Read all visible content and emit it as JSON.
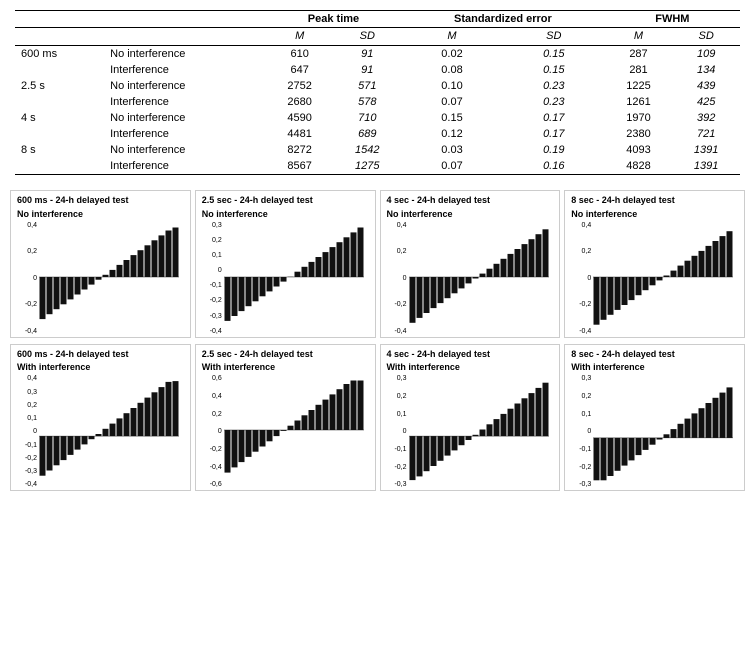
{
  "table": {
    "headers": {
      "groups": [
        {
          "label": "Peak time",
          "colspan": 2
        },
        {
          "label": "Standardized error",
          "colspan": 2
        },
        {
          "label": "FWHM",
          "colspan": 2
        }
      ],
      "subheaders": [
        "M",
        "SD",
        "M",
        "SD",
        "M",
        "SD"
      ]
    },
    "rows": [
      {
        "condition": "600 ms",
        "sub": "No interference",
        "peak_m": "610",
        "peak_sd": "91",
        "se_m": "0.02",
        "se_sd": "0.15",
        "fwhm_m": "287",
        "fwhm_sd": "109"
      },
      {
        "condition": "",
        "sub": "Interference",
        "peak_m": "647",
        "peak_sd": "91",
        "se_m": "0.08",
        "se_sd": "0.15",
        "fwhm_m": "281",
        "fwhm_sd": "134"
      },
      {
        "condition": "2.5 s",
        "sub": "No interference",
        "peak_m": "2752",
        "peak_sd": "571",
        "se_m": "0.10",
        "se_sd": "0.23",
        "fwhm_m": "1225",
        "fwhm_sd": "439"
      },
      {
        "condition": "",
        "sub": "Interference",
        "peak_m": "2680",
        "peak_sd": "578",
        "se_m": "0.07",
        "se_sd": "0.23",
        "fwhm_m": "1261",
        "fwhm_sd": "425"
      },
      {
        "condition": "4 s",
        "sub": "No interference",
        "peak_m": "4590",
        "peak_sd": "710",
        "se_m": "0.15",
        "se_sd": "0.17",
        "fwhm_m": "1970",
        "fwhm_sd": "392"
      },
      {
        "condition": "",
        "sub": "Interference",
        "peak_m": "4481",
        "peak_sd": "689",
        "se_m": "0.12",
        "se_sd": "0.17",
        "fwhm_m": "2380",
        "fwhm_sd": "721"
      },
      {
        "condition": "8 s",
        "sub": "No interference",
        "peak_m": "8272",
        "peak_sd": "1542",
        "se_m": "0.03",
        "se_sd": "0.19",
        "fwhm_m": "4093",
        "fwhm_sd": "1391"
      },
      {
        "condition": "",
        "sub": "Interference",
        "peak_m": "8567",
        "peak_sd": "1275",
        "se_m": "0.07",
        "se_sd": "0.16",
        "fwhm_m": "4828",
        "fwhm_sd": "1391"
      }
    ]
  },
  "charts": {
    "row1": {
      "title": "No interference",
      "charts": [
        {
          "label1": "600 ms - 24-h delayed test",
          "label2": "No interference",
          "ymax": 0.4,
          "ymin": -0.4,
          "yticks": [
            "0,4",
            "0,2",
            "0",
            "-0,2",
            "-0,4"
          ]
        },
        {
          "label1": "2.5 sec - 24-h delayed test",
          "label2": "No interference",
          "ymax": 0.4,
          "ymin": -0.4,
          "yticks": [
            "0,3",
            "0,2",
            "0,1",
            "0",
            "-0,1",
            "-0,2",
            "-0,3",
            "-0,4"
          ]
        },
        {
          "label1": "4 sec - 24-h delayed test",
          "label2": "No interference",
          "ymax": 0.4,
          "ymin": -0.4,
          "yticks": [
            "0,4",
            "0,2",
            "0",
            "-0,2",
            "-0,4"
          ]
        },
        {
          "label1": "8 sec - 24-h delayed test",
          "label2": "No interference",
          "ymax": 0.4,
          "ymin": -0.4,
          "yticks": [
            "0,4",
            "0,2",
            "0",
            "-0,2",
            "-0,4"
          ]
        }
      ]
    },
    "row2": {
      "title": "With interference",
      "charts": [
        {
          "label1": "600 ms - 24-h delayed test",
          "label2": "With interference",
          "ymax": 0.5,
          "ymin": -0.4,
          "yticks": [
            "0,4",
            "0,3",
            "0,2",
            "0,1",
            "0",
            "-0,1",
            "-0,2",
            "-0,3",
            "-0,4"
          ]
        },
        {
          "label1": "2.5 sec - 24-h delayed test",
          "label2": "With interference",
          "ymax": 0.6,
          "ymin": -0.6,
          "yticks": [
            "0,6",
            "0,4",
            "0,2",
            "0",
            "-0,2",
            "-0,4",
            "-0,6"
          ]
        },
        {
          "label1": "4 sec - 24-h delayed test",
          "label2": "With interference",
          "ymax": 0.5,
          "ymin": -0.4,
          "yticks": [
            "0,3",
            "0,2",
            "0,1",
            "0",
            "-0,1",
            "-0,2",
            "-0,3"
          ]
        },
        {
          "label1": "8 sec - 24-h delayed test",
          "label2": "With interference",
          "ymax": 0.4,
          "ymin": -0.3,
          "yticks": [
            "0,3",
            "0,2",
            "0,1",
            "0",
            "-0,1",
            "-0,2",
            "-0,3"
          ]
        }
      ]
    }
  }
}
